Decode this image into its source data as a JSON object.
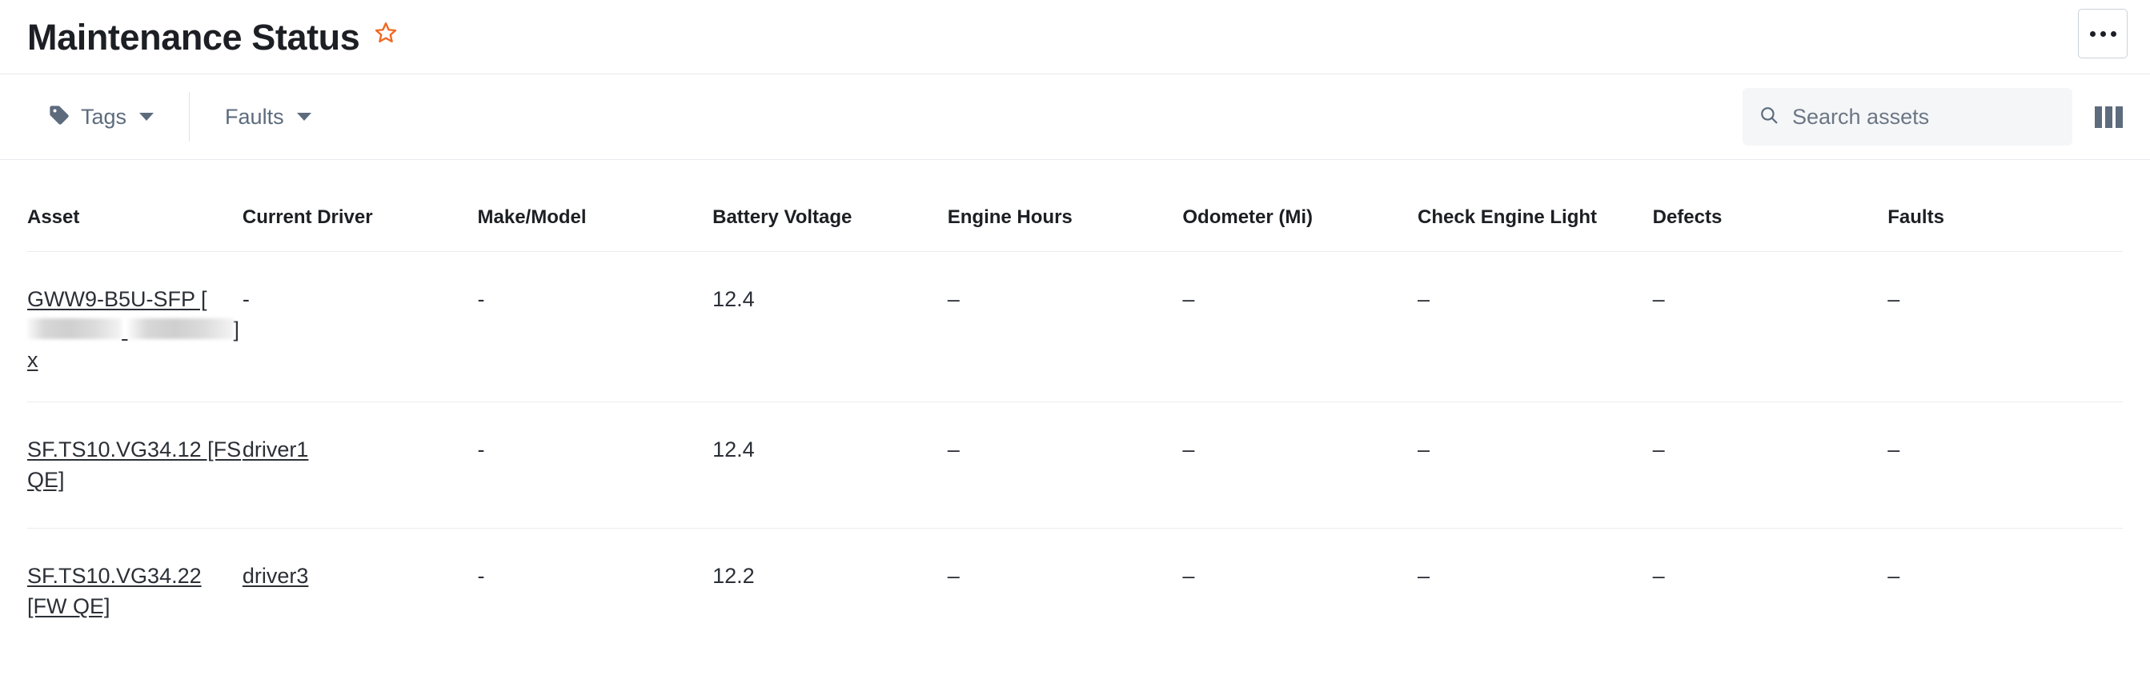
{
  "header": {
    "title": "Maintenance Status",
    "favorite_icon": "star-outline-icon",
    "favorite_color": "#F26722",
    "overflow_menu_label": "···"
  },
  "toolbar": {
    "tags_filter": {
      "label": "Tags",
      "icon": "tag-icon",
      "caret": "chevron-down-icon"
    },
    "faults_filter": {
      "label": "Faults",
      "caret": "chevron-down-icon"
    },
    "search": {
      "placeholder": "Search assets",
      "value": "",
      "icon": "search-icon"
    },
    "columns_toggle": {
      "icon": "columns-icon"
    }
  },
  "table": {
    "columns": [
      "Asset",
      "Current Driver",
      "Make/Model",
      "Battery Voltage",
      "Engine Hours",
      "Odometer (Mi)",
      "Check Engine Light",
      "Defects",
      "Faults"
    ],
    "rows": [
      {
        "asset_prefix": "GWW9-B5U-SFP [",
        "asset_redacted": true,
        "asset_suffix": "] x",
        "asset_is_link": true,
        "current_driver": "-",
        "current_driver_is_link": false,
        "make_model": "-",
        "battery_voltage": "12.4",
        "engine_hours": "–",
        "odometer": "–",
        "check_engine_light": "–",
        "defects": "–",
        "faults": "–"
      },
      {
        "asset_prefix": "SF.TS10.VG34.12 [FS QE]",
        "asset_redacted": false,
        "asset_suffix": "",
        "asset_is_link": true,
        "current_driver": "driver1",
        "current_driver_is_link": true,
        "make_model": "-",
        "battery_voltage": "12.4",
        "engine_hours": "–",
        "odometer": "–",
        "check_engine_light": "–",
        "defects": "–",
        "faults": "–"
      },
      {
        "asset_prefix": "SF.TS10.VG34.22 [FW QE]",
        "asset_redacted": false,
        "asset_suffix": "",
        "asset_is_link": true,
        "current_driver": "driver3",
        "current_driver_is_link": true,
        "make_model": "-",
        "battery_voltage": "12.2",
        "engine_hours": "–",
        "odometer": "–",
        "check_engine_light": "–",
        "defects": "–",
        "faults": "–"
      }
    ]
  }
}
